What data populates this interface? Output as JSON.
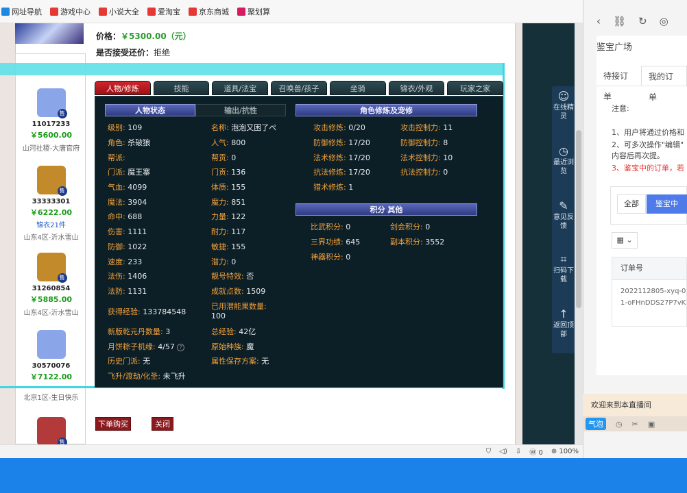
{
  "bookmarks": [
    {
      "label": "网址导航",
      "color": "#1e88e5"
    },
    {
      "label": "游戏中心",
      "color": "#e53935"
    },
    {
      "label": "小说大全",
      "color": "#e53935"
    },
    {
      "label": "爱淘宝",
      "color": "#e53935"
    },
    {
      "label": "京东商城",
      "color": "#e53935"
    },
    {
      "label": "聚划算",
      "color": "#d81b60"
    }
  ],
  "price": {
    "label": "价格：",
    "value": "￥5300.00（元）"
  },
  "bargain": {
    "label": "是否接受还价：",
    "value": "拒绝"
  },
  "listings": [
    {
      "id": "11017233",
      "price": "￥5600.00",
      "extra": "",
      "server": "山河社稷-大唐官府",
      "avatar": "#8aa6e8",
      "sell": "售"
    },
    {
      "id": "33333301",
      "price": "￥6222.00",
      "extra": "锦衣21件",
      "server": "山东4区-沂水雪山",
      "avatar": "#c28a2a",
      "sell": "售"
    },
    {
      "id": "31260854",
      "price": "￥5885.00",
      "extra": "",
      "server": "山东4区-沂水雪山",
      "avatar": "#c28a2a",
      "sell": "售"
    },
    {
      "id": "30570076",
      "price": "￥7122.00",
      "extra": "",
      "server": "北京1区-生日快乐",
      "avatar": "#8aa6e8",
      "sell": ""
    },
    {
      "id": "",
      "price": "",
      "extra": "",
      "server": "",
      "avatar": "#b23a3a",
      "sell": "售"
    }
  ],
  "tabs": [
    "人物/修炼",
    "技能",
    "道具/法宝",
    "召唤兽/孩子",
    "坐骑",
    "锦衣/外观",
    "玩家之家"
  ],
  "sections": {
    "char_status": "人物状态",
    "output": "输出/抗性",
    "cultivation": "角色修炼及宠修",
    "points": "积分 其他"
  },
  "stats_left": [
    {
      "k": "级别:",
      "v": "109"
    },
    {
      "k": "角色:",
      "v": "杀破狼"
    },
    {
      "k": "帮派:",
      "v": ""
    },
    {
      "k": "门派:",
      "v": "魔王寨"
    },
    {
      "k": "气血:",
      "v": "4099"
    },
    {
      "k": "魔法:",
      "v": "3904"
    },
    {
      "k": "命中:",
      "v": "688"
    },
    {
      "k": "伤害:",
      "v": "1111"
    },
    {
      "k": "防御:",
      "v": "1022"
    },
    {
      "k": "速度:",
      "v": "233"
    },
    {
      "k": "法伤:",
      "v": "1406"
    },
    {
      "k": "法防:",
      "v": "1131"
    }
  ],
  "stats_mid": [
    {
      "k": "名称:",
      "v": "泡泡又困了ぺ"
    },
    {
      "k": "人气:",
      "v": "800"
    },
    {
      "k": "帮贡:",
      "v": "0"
    },
    {
      "k": "门贡:",
      "v": "136"
    },
    {
      "k": "体质:",
      "v": "155"
    },
    {
      "k": "魔力:",
      "v": "851"
    },
    {
      "k": "力量:",
      "v": "122"
    },
    {
      "k": "耐力:",
      "v": "117"
    },
    {
      "k": "敏捷:",
      "v": "155"
    },
    {
      "k": "潜力:",
      "v": "0"
    },
    {
      "k": "靓号特效:",
      "v": "否"
    },
    {
      "k": "成就点数:",
      "v": "1509"
    }
  ],
  "stats_bottom": {
    "exp_k": "获得经验:",
    "exp_v": "133784548",
    "pot_k": "已用潜能果数量:",
    "pot_v": "100",
    "qyd_k": "新版乾元丹数量:",
    "qyd_v": "3",
    "total_k": "总经验:",
    "total_v": "42亿",
    "moon_k": "月饼粽子机缘:",
    "moon_v": "4/57",
    "race_k": "原始种族:",
    "race_v": "魔",
    "hist_k": "历史门派:",
    "hist_v": "无",
    "attr_k": "属性保存方案:",
    "attr_v": "无",
    "fly_k": "飞升/渡劫/化圣:",
    "fly_v": "未飞升"
  },
  "cultivation": [
    {
      "k": "攻击修炼:",
      "v": "0/20",
      "k2": "攻击控制力:",
      "v2": "11"
    },
    {
      "k": "防御修炼:",
      "v": "17/20",
      "k2": "防御控制力:",
      "v2": "8"
    },
    {
      "k": "法术修炼:",
      "v": "17/20",
      "k2": "法术控制力:",
      "v2": "10"
    },
    {
      "k": "抗法修炼:",
      "v": "17/20",
      "k2": "抗法控制力:",
      "v2": "0"
    },
    {
      "k": "猎术修炼:",
      "v": "1",
      "k2": "",
      "v2": ""
    }
  ],
  "points": [
    {
      "k": "比武积分:",
      "v": "0",
      "k2": "剑会积分:",
      "v2": "0"
    },
    {
      "k": "三界功绩:",
      "v": "645",
      "k2": "副本积分:",
      "v2": "3552"
    },
    {
      "k": "神器积分:",
      "v": "0",
      "k2": "",
      "v2": ""
    }
  ],
  "buttons": {
    "buy": "下单购买",
    "close": "关闭"
  },
  "float_bar": [
    {
      "icon": "☺",
      "label": "在线精灵"
    },
    {
      "icon": "◷",
      "label": "最近浏览"
    },
    {
      "icon": "✎",
      "label": "意见反馈"
    },
    {
      "icon": "⌗",
      "label": "扫码下载"
    },
    {
      "icon": "↑",
      "label": "返回顶部"
    }
  ],
  "right_panel": {
    "title": "鉴宝广场",
    "tabs": [
      "待接订单",
      "我的订单"
    ],
    "notice_title": "注意:",
    "notice_1": "1、用户将通过价格和",
    "notice_2": "2、可多次操作\"编辑\"",
    "notice_3": "内容后再次提。",
    "notice_4": "3、鉴宝中的订单，若",
    "filter_all": "全部",
    "filter_active": "鉴宝中",
    "col_order": "订单号",
    "order_no": "2022112805-xyq-01-oFHnDDS27P7vK",
    "footer": "欢迎来到本直播间",
    "bubble": "气泡"
  },
  "status_bar": {
    "count": "0",
    "zoom": "100%"
  }
}
